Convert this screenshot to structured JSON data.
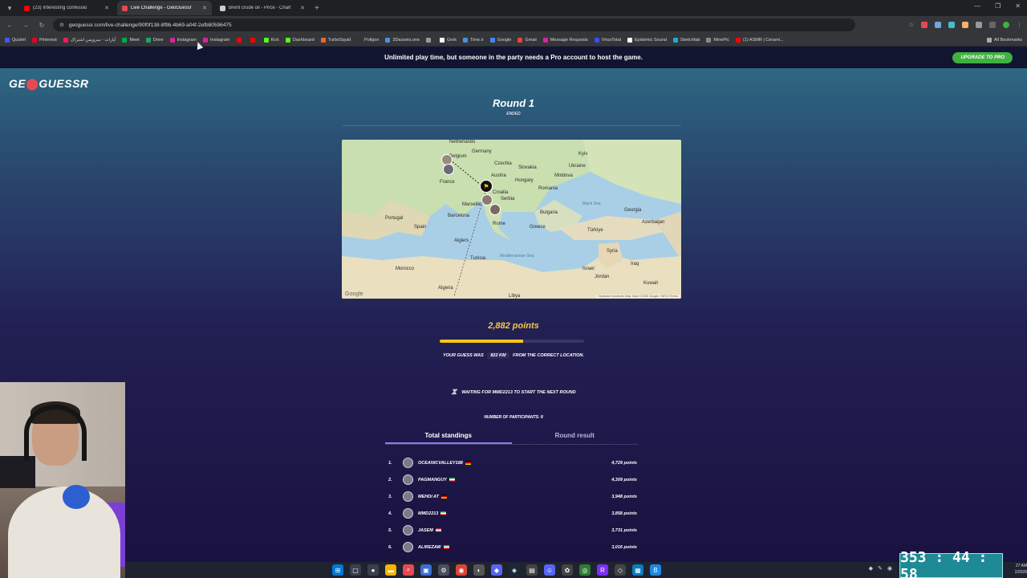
{
  "browser": {
    "tabs": [
      {
        "title": "(23) Interesting confessio",
        "color": "#ff0000",
        "active": false
      },
      {
        "title": "Live Challenge - GeoGuessr",
        "color": "#e84855",
        "active": true
      },
      {
        "title": "Brent crude oil - Price - Chart",
        "color": "#cccccc",
        "active": false
      }
    ],
    "url": "geoguessr.com/live-challenge/90f0f138-8f9b-4b69-a04f-2efb80596475",
    "bookmarks": [
      {
        "label": "Quizlet",
        "color": "#4255ff"
      },
      {
        "label": "Pinterest",
        "color": "#e60023"
      },
      {
        "label": "آپارات - سرویس اشتراک",
        "color": "#ea1d5d"
      },
      {
        "label": "Meet",
        "color": "#00ac47"
      },
      {
        "label": "Drive",
        "color": "#1fa463"
      },
      {
        "label": "Instagram",
        "color": "#d6249f"
      },
      {
        "label": "Instagram",
        "color": "#d6249f"
      },
      {
        "label": "",
        "color": "#ff0000"
      },
      {
        "label": "",
        "color": "#ff0000"
      },
      {
        "label": "Kick",
        "color": "#53fc18"
      },
      {
        "label": "Dashboard",
        "color": "#53fc18"
      },
      {
        "label": "TurboSquid",
        "color": "#f26522"
      },
      {
        "label": "Poligon",
        "color": "#333333"
      },
      {
        "label": "3Dassets.one",
        "color": "#4a90e2"
      },
      {
        "label": "",
        "color": "#999999"
      },
      {
        "label": "Grok",
        "color": "#ffffff"
      },
      {
        "label": "Time.ir",
        "color": "#4a90e2"
      },
      {
        "label": "Google",
        "color": "#4285f4"
      },
      {
        "label": "Gmail",
        "color": "#ea4335"
      },
      {
        "label": "Message Requests",
        "color": "#d6249f"
      },
      {
        "label": "VirusTotal",
        "color": "#394eff"
      },
      {
        "label": "Epidemic Sound",
        "color": "#ffffff"
      },
      {
        "label": "Sketchfab",
        "color": "#1caad9"
      },
      {
        "label": "MinePic",
        "color": "#888888"
      },
      {
        "label": "(1) ASMR | Cerami...",
        "color": "#ff0000"
      }
    ],
    "all_bookmarks": "All Bookmarks"
  },
  "page": {
    "banner_text": "Unlimited play time, but someone in the party needs a Pro account to host the game.",
    "upgrade_label": "UPGRADE TO PRO",
    "logo_left": "GE",
    "logo_pin": "⬤",
    "logo_right": "GUESSR",
    "round_title": "Round 1",
    "round_status": "ENDED",
    "map": {
      "labels": [
        {
          "text": "Germany",
          "sea": false
        },
        {
          "text": "Czechia",
          "sea": false
        },
        {
          "text": "Slovakia",
          "sea": false
        },
        {
          "text": "Ukraine",
          "sea": false
        },
        {
          "text": "Kyiv",
          "sea": false
        },
        {
          "text": "Moldova",
          "sea": false
        },
        {
          "text": "Austria",
          "sea": false
        },
        {
          "text": "Hungary",
          "sea": false
        },
        {
          "text": "Romania",
          "sea": false
        },
        {
          "text": "France",
          "sea": false
        },
        {
          "text": "Croatia",
          "sea": false
        },
        {
          "text": "Serbia",
          "sea": false
        },
        {
          "text": "Bulgaria",
          "sea": false
        },
        {
          "text": "Georgia",
          "sea": false
        },
        {
          "text": "Portugal",
          "sea": false
        },
        {
          "text": "Spain",
          "sea": false
        },
        {
          "text": "Greece",
          "sea": false
        },
        {
          "text": "Türkiye",
          "sea": false
        },
        {
          "text": "Azerbaijan",
          "sea": false
        },
        {
          "text": "Syria",
          "sea": false
        },
        {
          "text": "Iraq",
          "sea": false
        },
        {
          "text": "Tunisia",
          "sea": false
        },
        {
          "text": "Morocco",
          "sea": false
        },
        {
          "text": "Jordan",
          "sea": false
        },
        {
          "text": "Kuwait",
          "sea": false
        },
        {
          "text": "Algeria",
          "sea": false
        },
        {
          "text": "Libya",
          "sea": false
        },
        {
          "text": "Israel",
          "sea": false
        },
        {
          "text": "Belgium",
          "sea": false
        },
        {
          "text": "Netherlands",
          "sea": false
        },
        {
          "text": "Black Sea",
          "sea": true
        },
        {
          "text": "Mediterranean Sea",
          "sea": true
        },
        {
          "text": "Barcelona",
          "sea": false
        },
        {
          "text": "Marseille",
          "sea": false
        },
        {
          "text": "Rome",
          "sea": false
        },
        {
          "text": "Algiers",
          "sea": false
        }
      ],
      "google": "Google",
      "attribution": "Keyboard shortcuts   Map Data ©2026 Google, INEGI   Terms"
    },
    "points": "2,882 points",
    "progress_fraction": 0.58,
    "guess_prefix": "YOUR GUESS WAS",
    "guess_km": "822 KM",
    "guess_suffix": "FROM THE CORRECT LOCATION.",
    "waiting_text": "WAITING FOR MMD2213 TO START THE NEXT ROUND",
    "participants_text": "NUMBER OF PARTICIPANTS: 8",
    "tab_total": "Total standings",
    "tab_round": "Round result",
    "standings": [
      {
        "rank": "1.",
        "name": "OCEANICVALLEY188",
        "flag": [
          "#000000",
          "#dd0000",
          "#ffce00"
        ],
        "points": "4,729 points"
      },
      {
        "rank": "2.",
        "name": "PAGMANGUY",
        "flag": [
          "#239f40",
          "#ffffff",
          "#da0000"
        ],
        "points": "4,309 points"
      },
      {
        "rank": "3.",
        "name": "MEHDI AT",
        "flag": [
          "#000000",
          "#dd0000",
          "#ffce00"
        ],
        "points": "3,948 points"
      },
      {
        "rank": "4.",
        "name": "MMD2213",
        "flag": [
          "#239f40",
          "#ffffff",
          "#da0000"
        ],
        "points": "3,858 points"
      },
      {
        "rank": "5.",
        "name": "JASEM",
        "flag": [
          "#b22234",
          "#ffffff",
          "#3c3b6e"
        ],
        "points": "3,731 points"
      },
      {
        "rank": "6.",
        "name": "ALIREZAW",
        "flag": [
          "#239f40",
          "#ffffff",
          "#da0000"
        ],
        "points": "3,016 points"
      }
    ]
  },
  "timer": "353 : 44 : 58",
  "clock": {
    "time": "27 AM",
    "date": "2/2026"
  }
}
